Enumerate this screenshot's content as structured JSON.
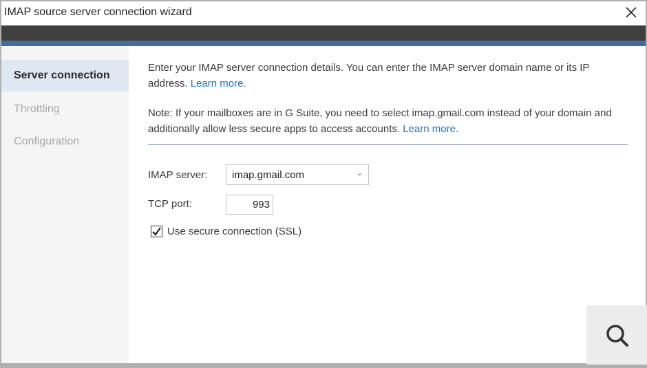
{
  "window": {
    "title": "IMAP source server connection wizard",
    "close_icon": "close-icon"
  },
  "sidebar": {
    "items": [
      {
        "label": "Server connection",
        "active": true
      },
      {
        "label": "Throttling",
        "active": false
      },
      {
        "label": "Configuration",
        "active": false
      }
    ]
  },
  "main": {
    "intro_text": "Enter your IMAP server connection details. You can enter the IMAP server domain name or its IP address.",
    "intro_link": "Learn more.",
    "note_text": "Note: If your mailboxes are in G Suite, you need to select imap.gmail.com instead of your domain and additionally allow less secure apps to access accounts.",
    "note_link": "Learn more.",
    "imap_server_label": "IMAP server:",
    "imap_server_value": "imap.gmail.com",
    "tcp_port_label": "TCP port:",
    "tcp_port_value": "993",
    "ssl_label": "Use secure connection (SSL)",
    "ssl_checked": true
  },
  "overlay": {
    "search_icon": "search-icon"
  },
  "colors": {
    "accent_bar": "#4a6a98",
    "dark_bar": "#3f3f3f",
    "link": "#2a72b5",
    "active_nav": "#dfe7f2"
  }
}
